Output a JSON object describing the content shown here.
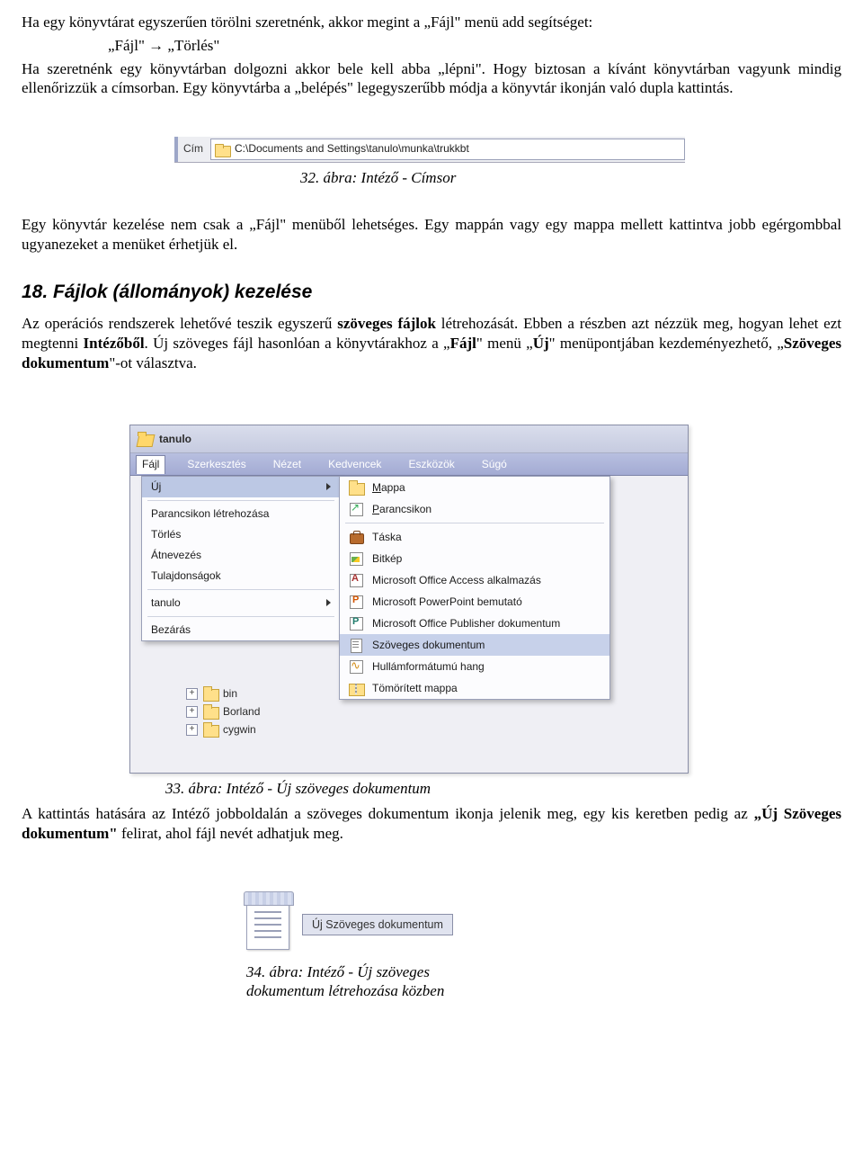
{
  "para1_a": "Ha egy könyvtárat egyszerűen törölni szeretnénk, akkor megint a „Fájl\" menü add segítséget:",
  "para1_b": "„Fájl\" → „Törlés\"",
  "para2": "Ha szeretnénk egy könyvtárban dolgozni akkor bele kell abba „lépni\". Hogy biztosan a kívánt könyvtárban vagyunk mindig ellenőrizzük a címsorban. Egy könyvtárba a „belépés\" legegyszerűbb módja a könyvtár ikonján való dupla kattintás.",
  "fig32": {
    "label": "Cím",
    "path": "C:\\Documents and Settings\\tanulo\\munka\\trukkbt",
    "caption": "32. ábra: Intéző - Címsor"
  },
  "para3": "Egy könyvtár kezelése nem csak a „Fájl\" menüből lehetséges. Egy mappán vagy egy mappa mellett kattintva jobb egérgombbal ugyanezeket a menüket érhetjük el.",
  "section18_title": "18.  Fájlok (állományok) kezelése",
  "para4_a": "Az operációs rendszerek lehetővé teszik egyszerű ",
  "para4_b": "szöveges fájlok",
  "para4_c": " létrehozását. Ebben a részben azt nézzük meg, hogyan lehet ezt megtenni ",
  "para4_d": "Intézőből",
  "para4_e": ". Új szöveges fájl hasonlóan a könyvtárakhoz a „",
  "para4_f": "Fájl",
  "para4_g": "\" menü „",
  "para4_h": "Új",
  "para4_i": "\" menüpontjában kezdeményezhető, „",
  "para4_j": "Szöveges dokumentum",
  "para4_k": "\"-ot választva.",
  "explorer": {
    "title": "tanulo",
    "menubar": [
      "Fájl",
      "Szerkesztés",
      "Nézet",
      "Kedvencek",
      "Eszközök",
      "Súgó"
    ],
    "file_menu": {
      "uj": "Új",
      "items_group_a": [
        "Parancsikon létrehozása",
        "Törlés",
        "Átnevezés",
        "Tulajdonságok"
      ],
      "tanulo": "tanulo",
      "bezaras": "Bezárás"
    },
    "submenu": [
      {
        "icon": "folder",
        "label": "Mappa",
        "underline": "M"
      },
      {
        "icon": "shortcut",
        "label": "Parancsikon",
        "underline": "P"
      },
      {
        "sep": true
      },
      {
        "icon": "bag",
        "label": "Táska"
      },
      {
        "icon": "bmp",
        "label": "Bitkép"
      },
      {
        "icon": "access",
        "label": "Microsoft Office Access alkalmazás"
      },
      {
        "icon": "ppt",
        "label": "Microsoft PowerPoint bemutató"
      },
      {
        "icon": "pub",
        "label": "Microsoft Office Publisher dokumentum"
      },
      {
        "icon": "txt",
        "label": "Szöveges dokumentum",
        "selected": true
      },
      {
        "icon": "wav",
        "label": "Hullámformátumú hang"
      },
      {
        "icon": "zip",
        "label": "Tömörített mappa"
      }
    ],
    "tree": [
      "bin",
      "Borland",
      "cygwin"
    ]
  },
  "fig33_caption": "33. ábra: Intéző - Új szöveges dokumentum",
  "para5_a": "A kattintás hatására az Intéző jobboldalán a szöveges dokumentum ikonja jelenik meg, egy kis keretben pedig az ",
  "para5_b": "„Új Szöveges dokumentum\"",
  "para5_c": " felirat, ahol fájl nevét adhatjuk meg.",
  "fig34": {
    "label": "Új Szöveges dokumentum",
    "caption_a": "34. ábra: Intéző - Új szöveges",
    "caption_b": "dokumentum létrehozása közben"
  }
}
